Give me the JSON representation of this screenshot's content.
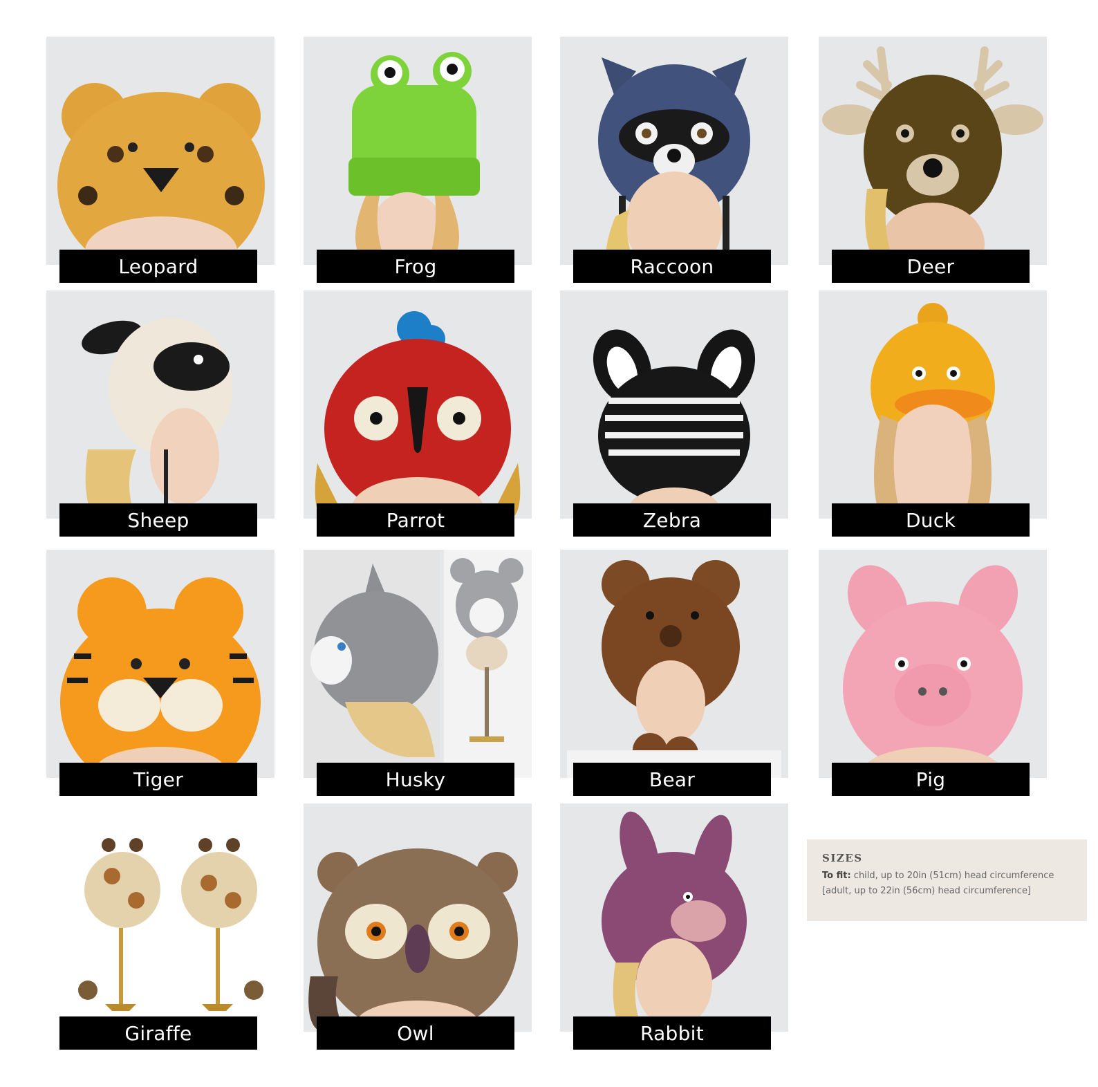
{
  "items": [
    {
      "label": "Leopard"
    },
    {
      "label": "Frog"
    },
    {
      "label": "Raccoon"
    },
    {
      "label": "Deer"
    },
    {
      "label": "Sheep"
    },
    {
      "label": "Parrot"
    },
    {
      "label": "Zebra"
    },
    {
      "label": "Duck"
    },
    {
      "label": "Tiger"
    },
    {
      "label": "Husky"
    },
    {
      "label": "Bear"
    },
    {
      "label": "Pig"
    },
    {
      "label": "Giraffe"
    },
    {
      "label": "Owl"
    },
    {
      "label": "Rabbit"
    }
  ],
  "sizes": {
    "heading": "SIZES",
    "fit_label": "To fit:",
    "child": "child, up to 20in (51cm) head circumference",
    "adult": "[adult, up to 22in (56cm) head circumference]"
  },
  "colors": {
    "label_background": "#000000",
    "label_text": "#ffffff",
    "photo_background": "#e6e7e9"
  }
}
